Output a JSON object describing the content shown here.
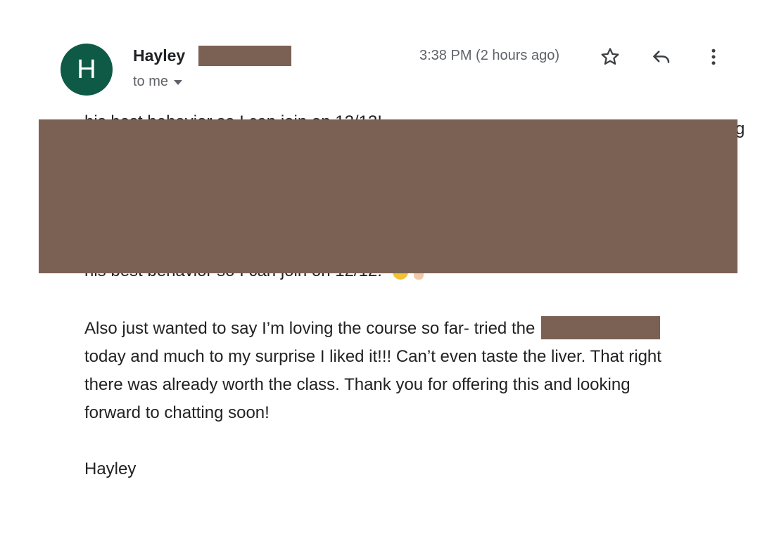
{
  "sender": {
    "avatar_letter": "H",
    "name": "Hayley",
    "recipient_label": "to me"
  },
  "timestamp": "3:38 PM (2 hours ago)",
  "toolbar": {
    "icons": [
      "star-icon",
      "reply-icon",
      "more-vert-icon"
    ]
  },
  "body": {
    "lines": [
      "Also just wanted to say I’m loving the course so far- tried the",
      "today and much to my surprise I liked it!!! Can’t even taste the liver. That right",
      "there was already worth the class. Thank you for offering this and looking",
      "forward to chatting soon!"
    ],
    "partial_visible_text": "his best behavior so I can join on 12/12!",
    "edge_fragment": "g",
    "signoff": "Hayley"
  },
  "colors": {
    "avatar": "#0f5a46",
    "redaction": "#7b6154",
    "secondary_text": "#5f6368"
  }
}
